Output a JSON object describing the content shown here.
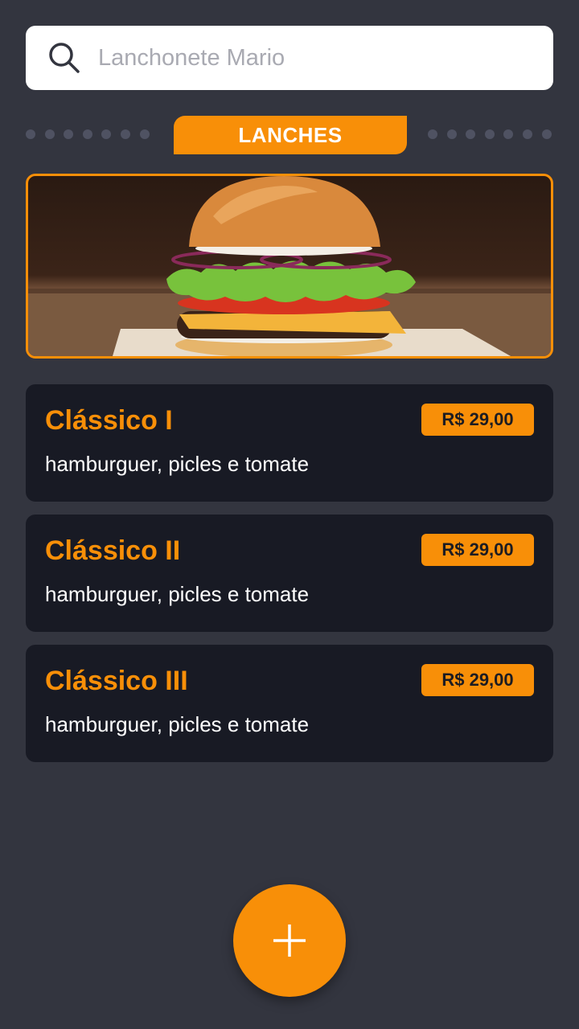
{
  "search": {
    "placeholder": "Lanchonete Mario",
    "icon": "search-icon"
  },
  "category_tab": {
    "label": "LANCHES"
  },
  "colors": {
    "accent": "#f88f08",
    "background": "#33353f",
    "card": "#181a24"
  },
  "items": [
    {
      "name": "Clássico I",
      "description": "hamburguer, picles e tomate",
      "price": "R$ 29,00"
    },
    {
      "name": "Clássico II",
      "description": "hamburguer, picles e tomate",
      "price": "R$ 29,00"
    },
    {
      "name": "Clássico III",
      "description": "hamburguer, picles e tomate",
      "price": "R$ 29,00"
    }
  ],
  "fab": {
    "icon": "plus-icon"
  }
}
